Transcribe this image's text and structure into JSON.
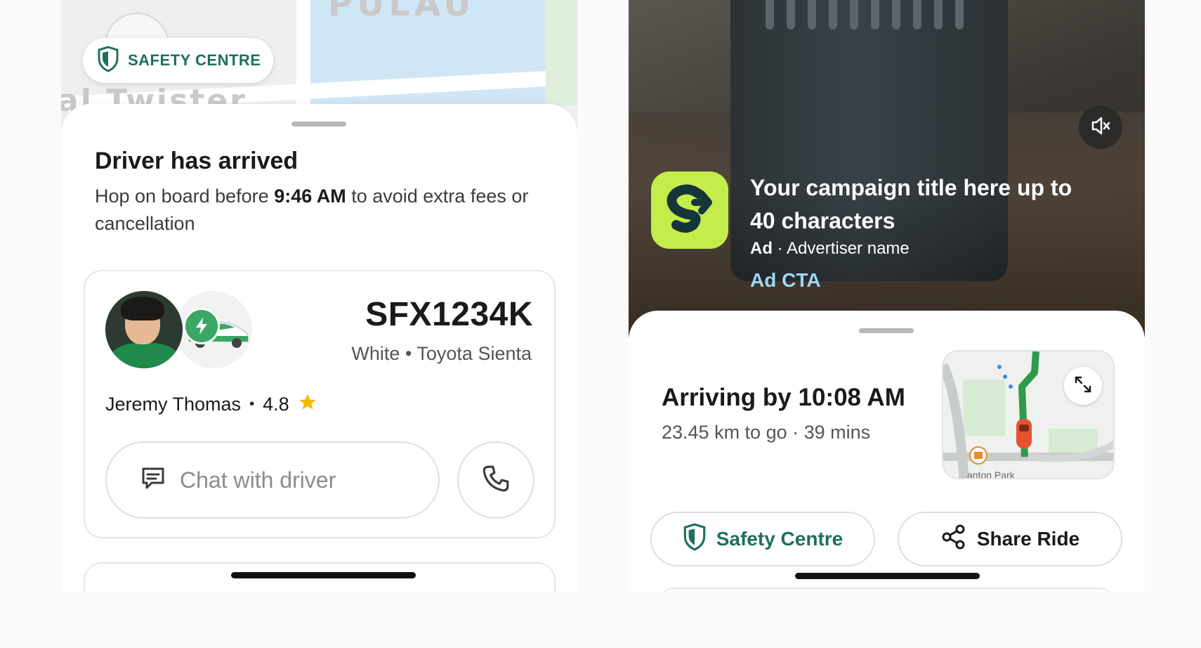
{
  "left_screen": {
    "safety_pill_label": "SAFETY CENTRE",
    "title": "Driver has arrived",
    "desc_prefix": "Hop on board before ",
    "desc_time": "9:46 AM",
    "desc_suffix": " to avoid extra fees or cancellation",
    "plate": "SFX1234K",
    "car_description": "White • Toyota Sienta",
    "driver_name": "Jeremy Thomas",
    "rating": "4.8",
    "chat_label": "Chat with driver",
    "colors": {
      "accent_green": "#1f6f5f",
      "badge_green": "#3aa864",
      "star": "#f5b800"
    }
  },
  "right_screen": {
    "ad": {
      "title": "Your campaign title here up to 40 characters",
      "ad_label": "Ad",
      "advertiser": "Advertiser name",
      "cta": "Ad CTA",
      "icon_bg": "#c4ec4a"
    },
    "arrival_title": "Arriving by 10:08 AM",
    "arrival_subtitle": "23.45 km to go · 39 mins",
    "map_label": "…anton Park",
    "safety_button_label": "Safety Centre",
    "share_button_label": "Share Ride"
  }
}
